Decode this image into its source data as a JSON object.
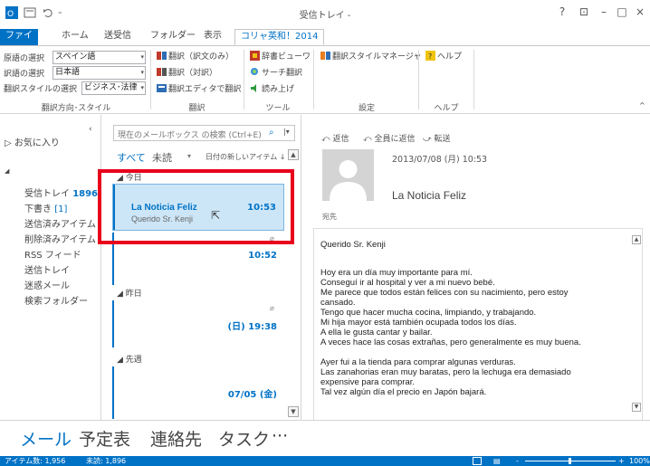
{
  "titlebar": {
    "title": "受信トレイ -",
    "help": "?",
    "ribbon_toggle": "⊡",
    "minimize": "–",
    "maximize": "□",
    "close": "×"
  },
  "tabs": [
    "ファイル",
    "ホーム",
    "送受信",
    "フォルダー",
    "表示",
    "コリャ英和！2014"
  ],
  "ribbon": {
    "source_lang_label": "原語の選択",
    "source_lang_value": "スペイン語",
    "target_lang_label": "訳語の選択",
    "target_lang_value": "日本語",
    "style_label": "翻訳スタイルの選択",
    "style_value": "ビジネス･法律",
    "btn_translate_only": "翻訳（訳文のみ）",
    "btn_translate_pair": "翻訳（対訳）",
    "btn_editor": "翻訳エディタで翻訳",
    "btn_dict": "辞書ビューワ",
    "btn_search": "サーチ翻訳",
    "btn_read": "読み上げ",
    "btn_style_mgr": "翻訳スタイルマネージャ",
    "btn_help": "ヘルプ",
    "group_direction": "翻訳方向･スタイル",
    "group_translate": "翻訳",
    "group_tools": "ツール",
    "group_settings": "設定",
    "group_help": "ヘルプ"
  },
  "folders": {
    "favorites": "お気に入り",
    "inbox": "受信トレイ",
    "inbox_count": "1896",
    "drafts": "下書き",
    "drafts_count": "[1]",
    "sent": "送信済みアイテム",
    "deleted": "削除済みアイテム",
    "rss": "RSS フィード",
    "outbox": "送信トレイ",
    "junk": "迷惑メール",
    "search_folders": "検索フォルダー"
  },
  "list": {
    "search_placeholder": "現在のメールボックス の検索 (Ctrl+E)",
    "filter_all": "すべて",
    "filter_unread": "未読",
    "sort": "日付の新しいアイテム ↓",
    "group_today": "今日",
    "group_yesterday": "昨日",
    "group_last_week": "先週",
    "messages": [
      {
        "subject": "La Noticia Feliz",
        "from": "Querido Sr. Kenji",
        "time": "10:53"
      },
      {
        "time": "10:52"
      },
      {
        "time": "(日) 19:38"
      },
      {
        "time": "07/05 (金)"
      }
    ]
  },
  "reading": {
    "reply": "返信",
    "reply_all": "全員に返信",
    "forward": "転送",
    "date": "2013/07/08 (月) 10:53",
    "subject": "La Noticia Feliz",
    "to_label": "宛先",
    "body": [
      "Querido Sr. Kenji",
      "",
      "Hoy era un día muy importante para mí.",
      "Conseguí ir al hospital y ver a mi nuevo bebé.",
      "Me parece que  todos están felices con su nacimiento, pero estoy",
      "cansado.",
      "Tengo que hacer mucha cocina, limpiando, y trabajando.",
      "Mi hija mayor está también ocupada todos los días.",
      "A ella le gusta cantar y bailar.",
      "A veces hace las cosas extrañas, pero generalmente es muy buena.",
      "",
      "Ayer fui a la tienda para comprar algunas verduras.",
      "Las zanahorias eran muy baratas, pero la lechuga era demasiado",
      "expensive para comprar.",
      "Tal vez algún día el precio en Japón bajará."
    ]
  },
  "nav": [
    "メール",
    "予定表",
    "連絡先",
    "タスク",
    "···"
  ],
  "status": {
    "items": "アイテム数: 1,956",
    "unread": "未読: 1,896",
    "zoom": "100%"
  },
  "colors": {
    "accent": "#0072c6",
    "highlight": "#e8001c"
  }
}
